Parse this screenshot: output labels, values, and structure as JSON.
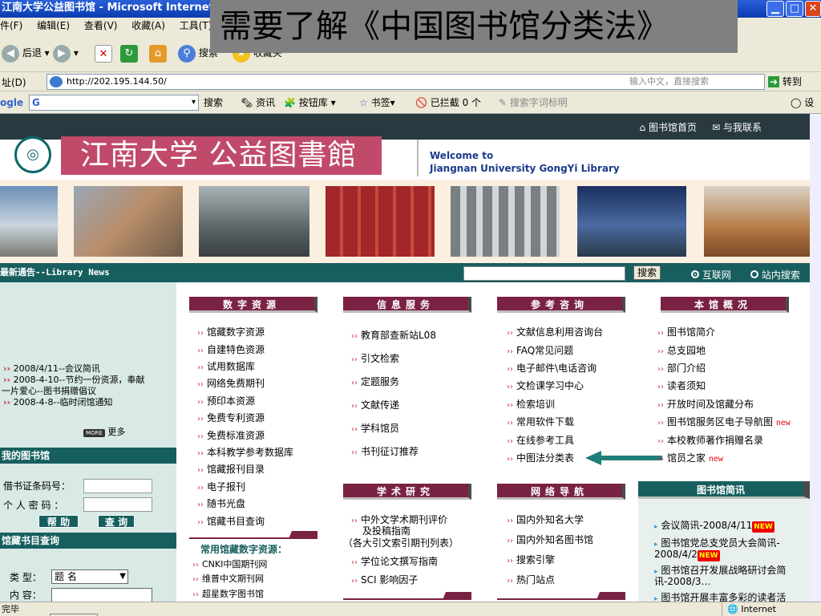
{
  "window": {
    "title": "江南大学公益图书馆 - Microsoft Internet Exp"
  },
  "overlay_caption": "需要了解《中国图书馆分类法》",
  "menu": [
    "件(F)",
    "编辑(E)",
    "查看(V)",
    "收藏(A)",
    "工具(T)"
  ],
  "toolbar": {
    "back": "后退",
    "search": "搜索",
    "favorites": "收藏夹"
  },
  "address": {
    "label": "址(D)",
    "url": "http://202.195.144.50/",
    "placeholder": "输入中文，直接搜索",
    "go": "转到"
  },
  "googlebar": {
    "logo": "ogle",
    "g": "G",
    "search": "搜索",
    "news": "资讯",
    "buttons": "按钮库",
    "bookmarks": "书签",
    "blocked": "已拦截 0 个",
    "highlight": "搜索字词标明",
    "settings": "设"
  },
  "header": {
    "home": "图书馆首页",
    "contact": "与我联系"
  },
  "logo": {
    "banner": "江南大学 公益图書館",
    "welcome1": "Welcome to",
    "welcome2": "Jiangnan University GongYi Library"
  },
  "newsbar": {
    "title": "最新通告--Library News",
    "search_btn": "搜索",
    "opt1": "互联网",
    "opt2": "站内搜索"
  },
  "news": {
    "items": [
      "2008/4/11--会议简讯",
      "2008-4-10--节约一份资源，奉献",
      "一片爱心--图书捐赠倡议",
      "2008-4-8--临时闭馆通知"
    ],
    "more_icon": "MORE",
    "more": "更多"
  },
  "mylib": {
    "title": "我的图书馆",
    "card_label": "借书证条码号：",
    "pwd_label": "个 人 密 码 ：",
    "help": "帮 助",
    "query": "查 询"
  },
  "catalog": {
    "title": "馆藏书目查询",
    "type_label": "类 型：",
    "type_value": "题 名",
    "content_label": "内 容："
  },
  "col1": {
    "title": "数字资源",
    "links": [
      "馆藏数字资源",
      "自建特色资源",
      "试用数据库",
      "网络免费期刊",
      "预印本资源",
      "免费专利资源",
      "免费标准资源",
      "本科教学参考数据库",
      "馆藏报刊目录",
      "电子报刊",
      "随书光盘",
      "馆藏书目查询"
    ],
    "sub_title": "常用馆藏数字资源：",
    "sub_links": [
      "CNKI中国期刊网",
      "维普中文期刊网",
      "超星数字图书馆"
    ]
  },
  "col2": {
    "title": "信息服务",
    "links": [
      "教育部查新站L08",
      "引文检索",
      "定题服务",
      "文献传递",
      "学科馆员",
      "书刊征订推荐"
    ],
    "title2": "学术研究",
    "links2": [
      "中外文学术期刊评价",
      "及投稿指南",
      "（各大引文索引期刊列表）",
      "学位论文撰写指南",
      "SCI 影响因子"
    ]
  },
  "col3": {
    "title": "参考咨询",
    "links": [
      "文献信息利用咨询台",
      "FAQ常见问题",
      "电子邮件\\电话咨询",
      "文检课学习中心",
      "检索培训",
      "常用软件下载",
      "在线参考工具",
      "中图法分类表"
    ],
    "title2": "网络导航",
    "links2": [
      "国内外知名大学",
      "国内外知名图书馆",
      "搜索引擎",
      "热门站点"
    ]
  },
  "col4": {
    "title": "本馆概况",
    "links": [
      "图书馆简介",
      "总支园地",
      "部门介绍",
      "读者须知",
      "开放时间及馆藏分布",
      "图书馆服务区电子导航图",
      "本校教师著作捐赠名录",
      "馆员之家"
    ],
    "new_label": "new",
    "brief_title": "图书馆简讯",
    "brief": [
      "会议简讯-2008/4/11",
      "图书馆党总支党员大会简讯-",
      "2008/4/2",
      "图书馆召开发展战略研讨会简",
      "讯-2008/3…",
      "图书馆开展丰富多彩的读者活"
    ],
    "new_badge": "NEW"
  },
  "status": {
    "left": "完毕",
    "zone": "Internet"
  },
  "colors": {
    "teal": "#175f5f",
    "maroon": "#7a2244",
    "banner": "#c14a6b"
  }
}
